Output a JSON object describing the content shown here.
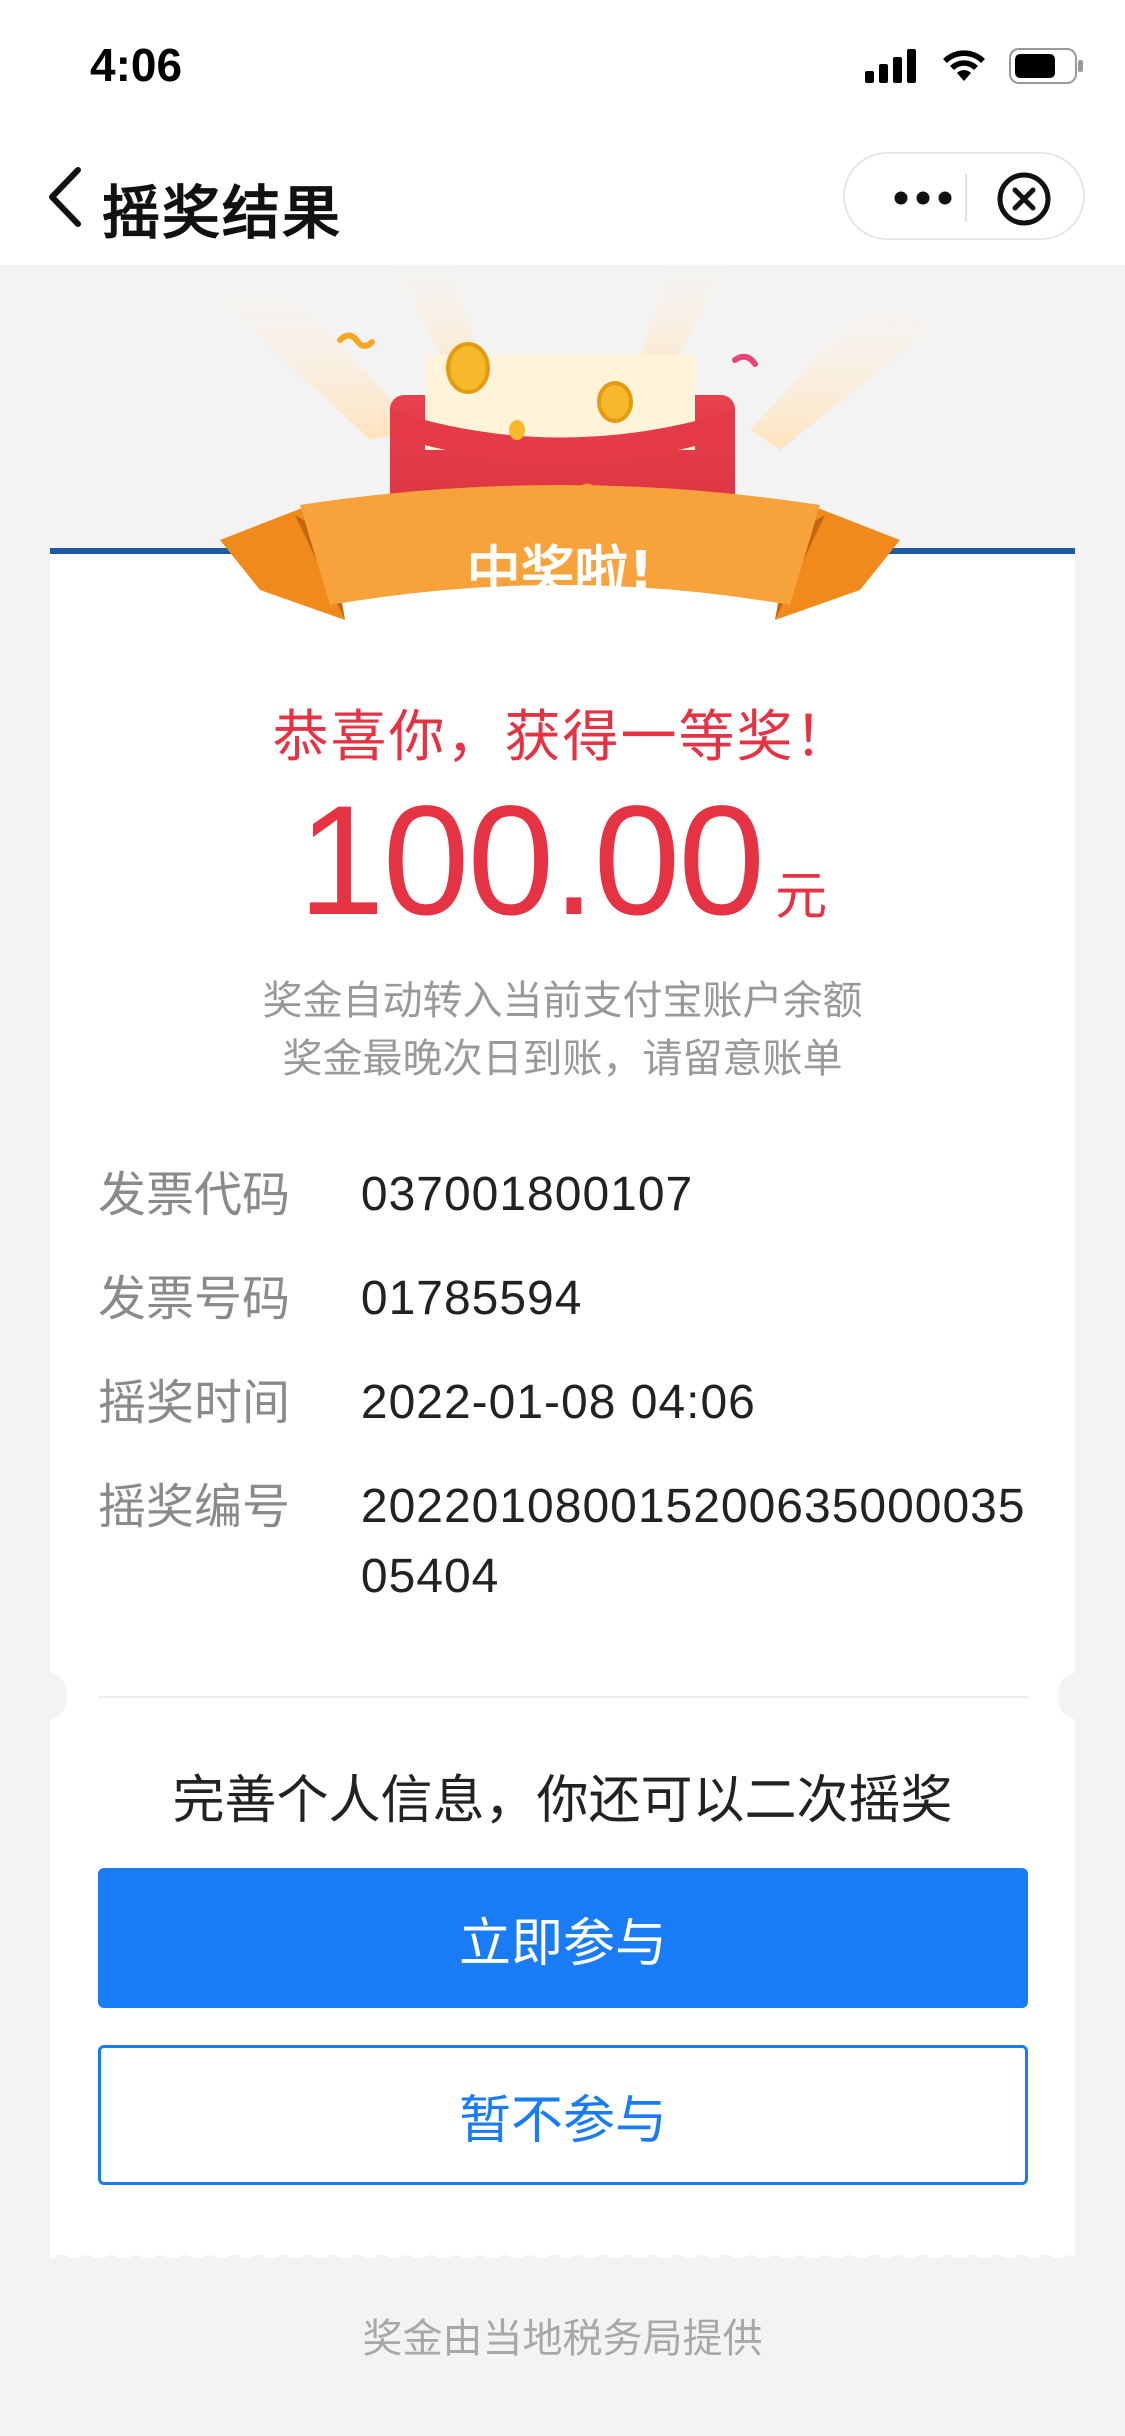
{
  "status_bar": {
    "time": "4:06"
  },
  "nav": {
    "title": "摇奖结果"
  },
  "hero": {
    "banner_text": "中奖啦!"
  },
  "result": {
    "congrats": "恭喜你，获得一等奖！",
    "amount": "100.00",
    "unit": "元",
    "note_line1": "奖金自动转入当前支付宝账户余额",
    "note_line2": "奖金最晚次日到账，请留意账单"
  },
  "info": [
    {
      "label": "发票代码",
      "value": "037001800107"
    },
    {
      "label": "发票号码",
      "value": "01785594"
    },
    {
      "label": "摇奖时间",
      "value": "2022-01-08 04:06"
    },
    {
      "label": "摇奖编号",
      "value": "20220108001520063500003505404"
    }
  ],
  "promo": {
    "text": "完善个人信息，你还可以二次摇奖"
  },
  "buttons": {
    "join": "立即参与",
    "skip": "暂不参与"
  },
  "footer": {
    "text": "奖金由当地税务局提供"
  },
  "colors": {
    "accent_blue": "#1a7cf5",
    "prize_red": "#e63344",
    "card_top_border": "#1f5aa6"
  },
  "icons": [
    "signal-icon",
    "wifi-icon",
    "battery-icon",
    "back-arrow-icon",
    "more-icon",
    "close-icon"
  ]
}
